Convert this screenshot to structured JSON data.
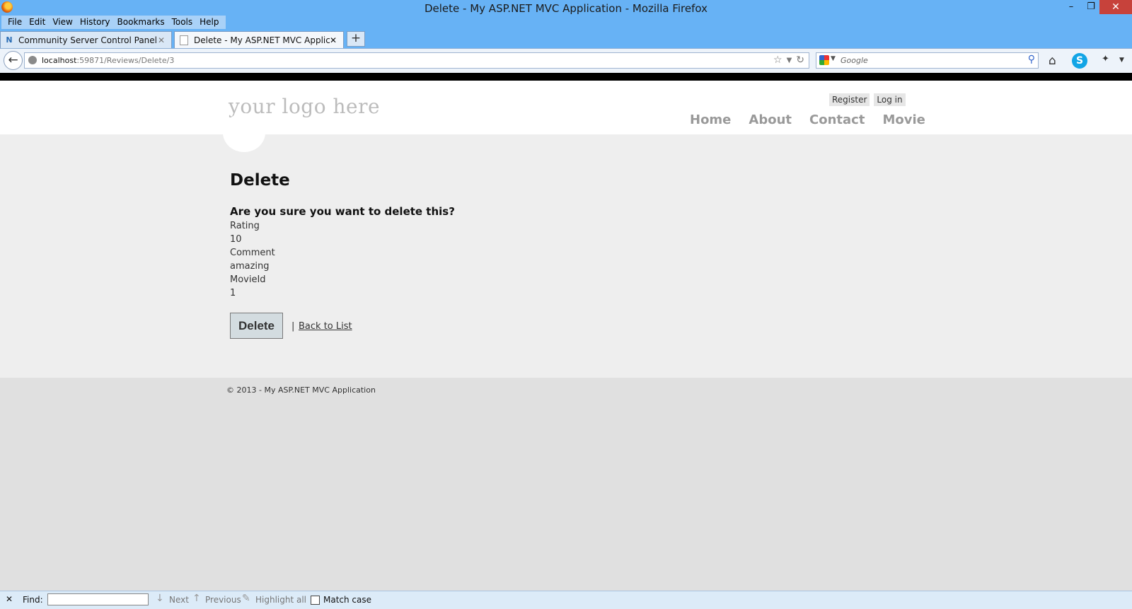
{
  "window": {
    "title": "Delete - My ASP.NET MVC Application - Mozilla Firefox"
  },
  "menu": [
    "File",
    "Edit",
    "View",
    "History",
    "Bookmarks",
    "Tools",
    "Help"
  ],
  "tabs": [
    {
      "label": "Community Server Control Panel",
      "icon": "asp-net-icon"
    },
    {
      "label": "Delete - My ASP.NET MVC Application",
      "icon": "page-icon"
    }
  ],
  "address": {
    "host": "localhost",
    "path": ":59871/Reviews/Delete/3"
  },
  "search": {
    "placeholder": "Google"
  },
  "site": {
    "logo": "your logo here",
    "register": "Register",
    "login": "Log in",
    "nav": [
      "Home",
      "About",
      "Contact",
      "Movie"
    ]
  },
  "page": {
    "heading": "Delete",
    "confirm": "Are you sure you want to delete this?",
    "fields": [
      {
        "label": "Rating",
        "value": "10"
      },
      {
        "label": "Comment",
        "value": "amazing"
      },
      {
        "label": "MovieId",
        "value": "1"
      }
    ],
    "delete_button": "Delete",
    "separator": "|",
    "back_link": "Back to List"
  },
  "footer": {
    "text": "© 2013 - My ASP.NET MVC Application"
  },
  "findbar": {
    "label": "Find:",
    "next": "Next",
    "previous": "Previous",
    "highlight": "Highlight all",
    "match_case": "Match case"
  },
  "colors": {
    "titlebar": "#67b2f5",
    "close": "#c7423b",
    "content_bg": "#eeeeee"
  }
}
